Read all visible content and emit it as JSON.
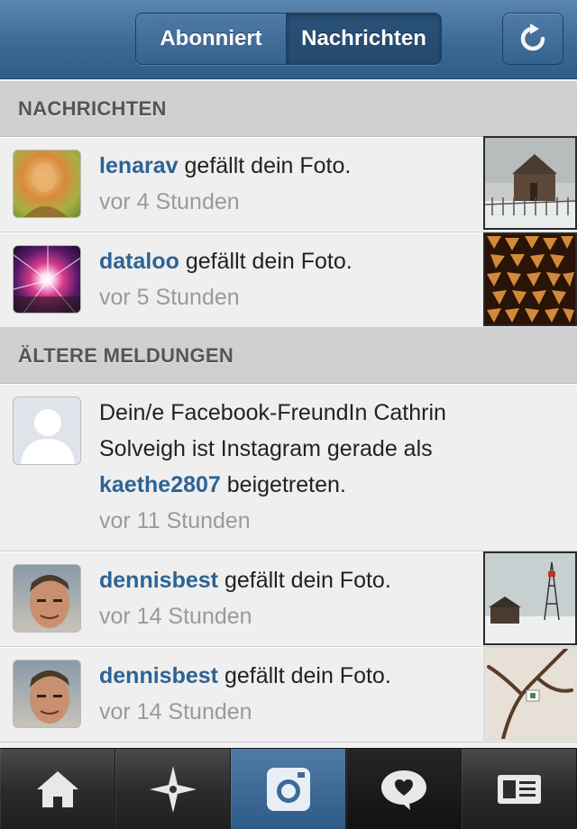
{
  "header": {
    "tabs": [
      {
        "label": "Abonniert",
        "selected": false
      },
      {
        "label": "Nachrichten",
        "selected": true
      }
    ],
    "refresh_icon": "refresh-icon"
  },
  "sections": [
    {
      "title": "NACHRICHTEN",
      "items": [
        {
          "username": "lenarav",
          "text": "gefällt dein Foto.",
          "time": "vor 4 Stunden",
          "thumb": "barn-photo"
        },
        {
          "username": "dataloo",
          "text": "gefällt dein Foto.",
          "time": "vor 5 Stunden",
          "thumb": "woodpile-photo"
        }
      ]
    },
    {
      "title": "ÄLTERE MELDUNGEN",
      "items": [
        {
          "text_prefix": "Dein/e Facebook-FreundIn Cathrin Solveigh ist Instagram gerade als",
          "username": "kaethe2807",
          "text_suffix": "beigetreten.",
          "time": "vor 11 Stunden"
        },
        {
          "username": "dennisbest",
          "text": "gefällt dein Foto.",
          "time": "vor 14 Stunden",
          "thumb": "tower-photo"
        },
        {
          "username": "dennisbest",
          "text": "gefällt dein Foto.",
          "time": "vor 14 Stunden",
          "thumb": "tree-photo"
        }
      ]
    }
  ],
  "tabbar": [
    {
      "icon": "home-icon",
      "active": false
    },
    {
      "icon": "explore-icon",
      "active": false
    },
    {
      "icon": "camera-icon",
      "active": true
    },
    {
      "icon": "news-icon",
      "active": false
    },
    {
      "icon": "profile-icon",
      "active": false
    }
  ],
  "colors": {
    "header_blue": "#3c6a97",
    "username_blue": "#2d6395",
    "time_gray": "#9a9a9a"
  }
}
